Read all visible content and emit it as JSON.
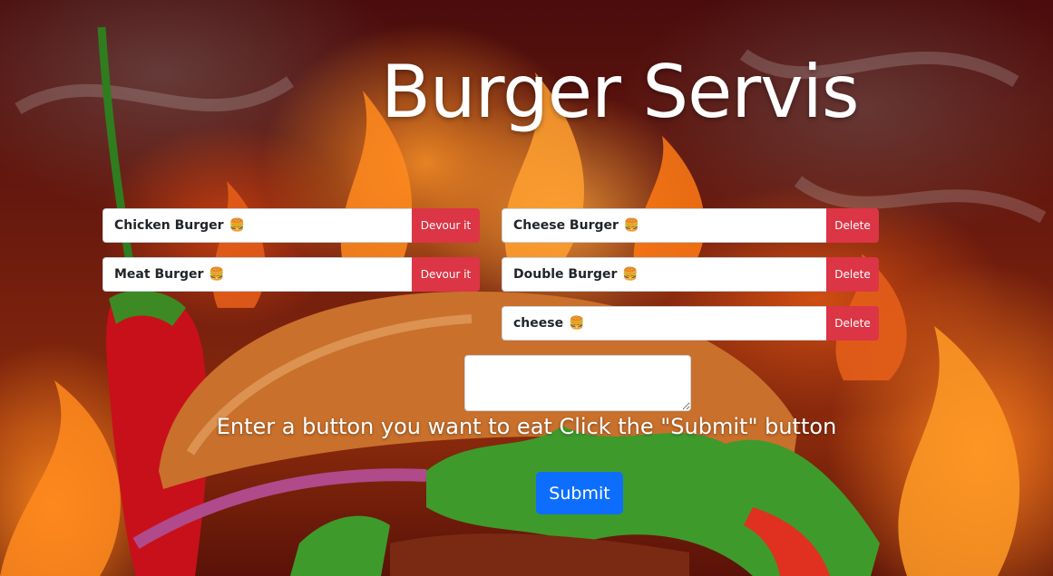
{
  "header": {
    "title": "Burger Servis"
  },
  "uneaten": {
    "items": [
      {
        "name": "Chicken Burger",
        "emoji": "🍔",
        "action": "Devour it"
      },
      {
        "name": "Meat Burger",
        "emoji": "🍔",
        "action": "Devour it"
      }
    ]
  },
  "devoured": {
    "items": [
      {
        "name": "Cheese Burger",
        "emoji": "🍔",
        "action": "Delete"
      },
      {
        "name": "Double Burger",
        "emoji": "🍔",
        "action": "Delete"
      },
      {
        "name": "cheese",
        "emoji": "🍔",
        "action": "Delete"
      }
    ]
  },
  "form": {
    "input_value": "",
    "instruction": "Enter a button you want to eat Click the \"Submit\" button",
    "submit_label": "Submit"
  },
  "colors": {
    "danger": "#dc3545",
    "primary": "#0d6efd",
    "title": "#ffffff"
  }
}
